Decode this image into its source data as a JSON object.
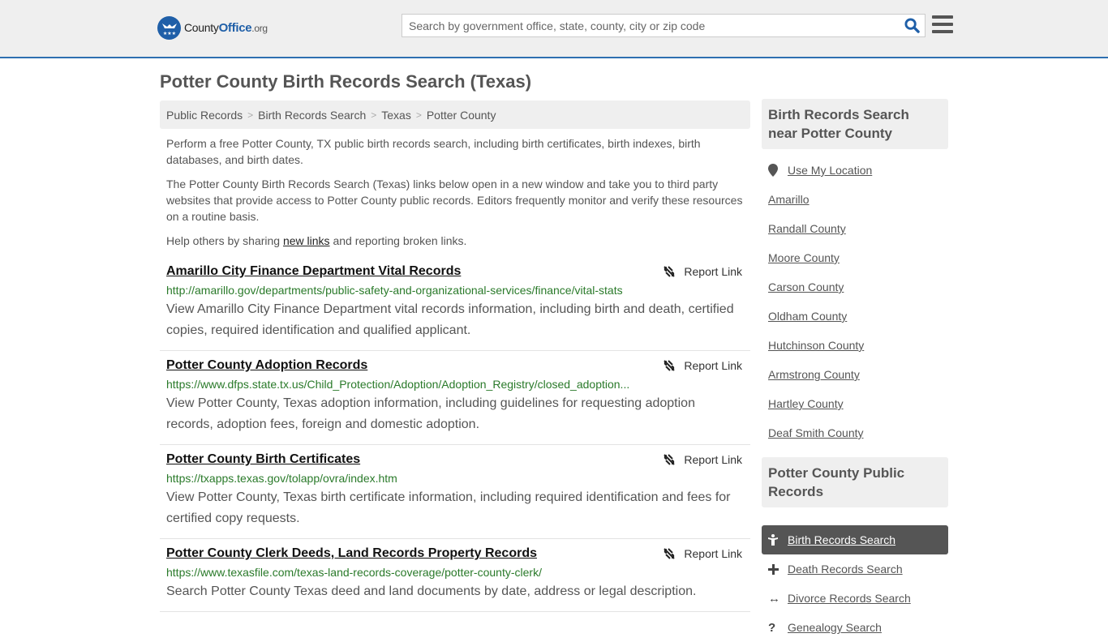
{
  "header": {
    "logo": {
      "name": "County",
      "name_bold": "Office",
      "tld": ".org"
    },
    "search_placeholder": "Search by government office, state, county, city or zip code",
    "search_value": ""
  },
  "page_title": "Potter County Birth Records Search (Texas)",
  "breadcrumb": [
    "Public Records",
    "Birth Records Search",
    "Texas",
    "Potter County"
  ],
  "intro": {
    "p1": "Perform a free Potter County, TX public birth records search, including birth certificates, birth indexes, birth databases, and birth dates.",
    "p2": "The Potter County Birth Records Search (Texas) links below open in a new window and take you to third party websites that provide access to Potter County public records. Editors frequently monitor and verify these resources on a routine basis.",
    "p3_before": "Help others by sharing ",
    "p3_link": "new links",
    "p3_after": " and reporting broken links."
  },
  "report_label": "Report Link",
  "records": [
    {
      "title": "Amarillo City Finance Department Vital Records",
      "url": "http://amarillo.gov/departments/public-safety-and-organizational-services/finance/vital-stats",
      "desc": "View Amarillo City Finance Department vital records information, including birth and death, certified copies, required identification and qualified applicant."
    },
    {
      "title": "Potter County Adoption Records",
      "url": "https://www.dfps.state.tx.us/Child_Protection/Adoption/Adoption_Registry/closed_adoption...",
      "desc": "View Potter County, Texas adoption information, including guidelines for requesting adoption records, adoption fees, foreign and domestic adoption."
    },
    {
      "title": "Potter County Birth Certificates",
      "url": "https://txapps.texas.gov/tolapp/ovra/index.htm",
      "desc": "View Potter County, Texas birth certificate information, including required identification and fees for certified copy requests."
    },
    {
      "title": "Potter County Clerk Deeds, Land Records Property Records",
      "url": "https://www.texasfile.com/texas-land-records-coverage/potter-county-clerk/",
      "desc": "Search Potter County Texas deed and land documents by date, address or legal description."
    }
  ],
  "sidebar": {
    "nearby_title": "Birth Records Search near Potter County",
    "use_location": "Use My Location",
    "nearby": [
      "Amarillo",
      "Randall County",
      "Moore County",
      "Carson County",
      "Oldham County",
      "Hutchinson County",
      "Armstrong County",
      "Hartley County",
      "Deaf Smith County"
    ],
    "public_title": "Potter County Public Records",
    "public_links": [
      {
        "label": "Birth Records Search",
        "icon": "birth-icon",
        "active": true
      },
      {
        "label": "Death Records Search",
        "icon": "plus-icon",
        "active": false
      },
      {
        "label": "Divorce Records Search",
        "icon": "arrows-icon",
        "active": false
      },
      {
        "label": "Genealogy Search",
        "icon": "question-icon",
        "active": false
      }
    ]
  }
}
